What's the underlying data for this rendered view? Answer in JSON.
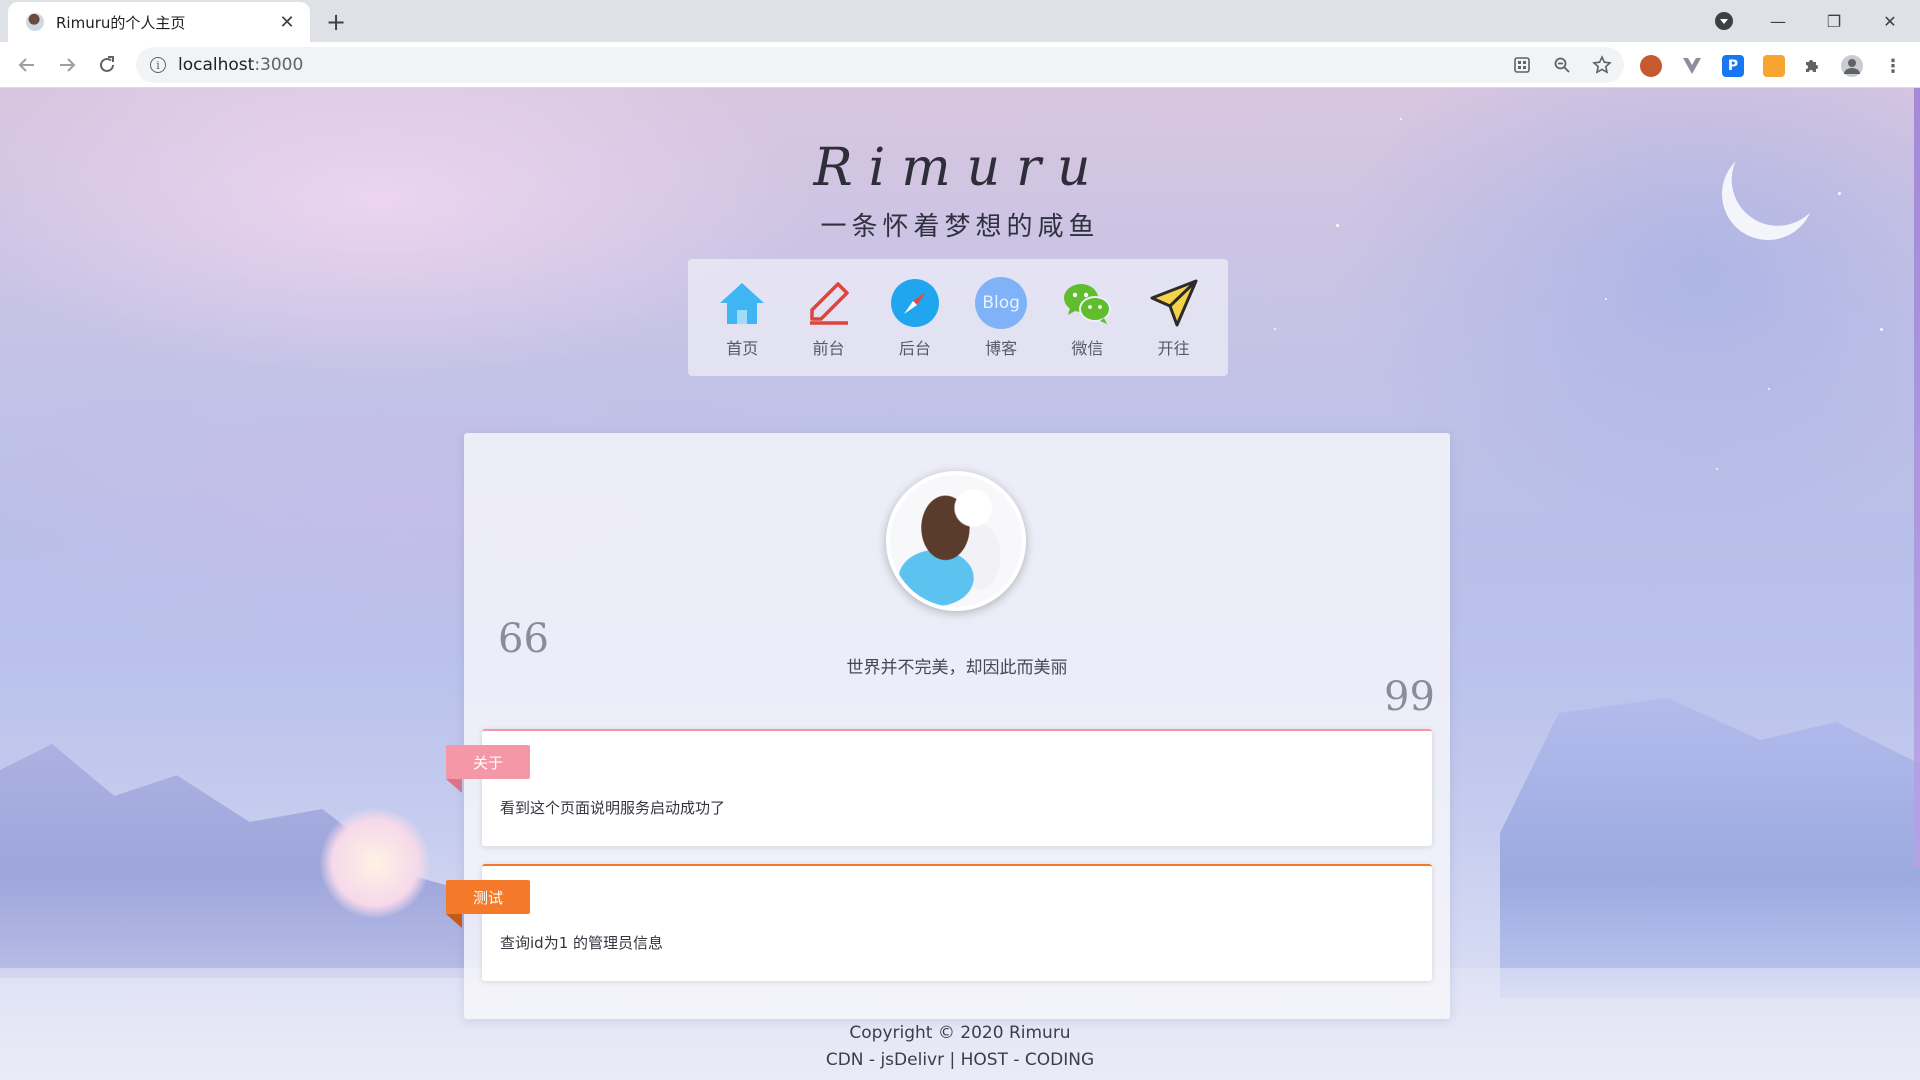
{
  "browser": {
    "tab_title": "Rimuru的个人主页",
    "tab_close": "✕",
    "new_tab": "+",
    "url_host": "localhost",
    "url_port": ":3000",
    "win_min": "—",
    "win_max": "❐",
    "win_close": "✕"
  },
  "site": {
    "title": "Rimuru",
    "subtitle": "一条怀着梦想的咸鱼"
  },
  "nav": [
    {
      "label": "首页",
      "icon": "home-icon"
    },
    {
      "label": "前台",
      "icon": "pencil-icon"
    },
    {
      "label": "后台",
      "icon": "compass-icon"
    },
    {
      "label": "博客",
      "icon": "blog-icon",
      "icon_text": "Blog"
    },
    {
      "label": "微信",
      "icon": "wechat-icon"
    },
    {
      "label": "开往",
      "icon": "paper-plane-icon"
    }
  ],
  "card": {
    "quote_open": "66",
    "quote_close": "99",
    "motto": "世界并不完美，却因此而美丽",
    "posts": [
      {
        "tag": "关于",
        "text": "看到这个页面说明服务启动成功了"
      },
      {
        "tag": "测试",
        "text": "查询id为1 的管理员信息"
      }
    ]
  },
  "footer": {
    "copyright": "Copyright © 2020 Rimuru",
    "hosting": "CDN - jsDelivr | HOST - CODING"
  },
  "colors": {
    "about_tag": "#f497a7",
    "test_tag": "#f4792a",
    "home_icon": "#3fb6f3",
    "pencil_icon": "#e0443a",
    "compass_icon": "#1fa6ee",
    "blog_icon": "#7fb2f7",
    "wechat_icon": "#5fbd2e"
  }
}
